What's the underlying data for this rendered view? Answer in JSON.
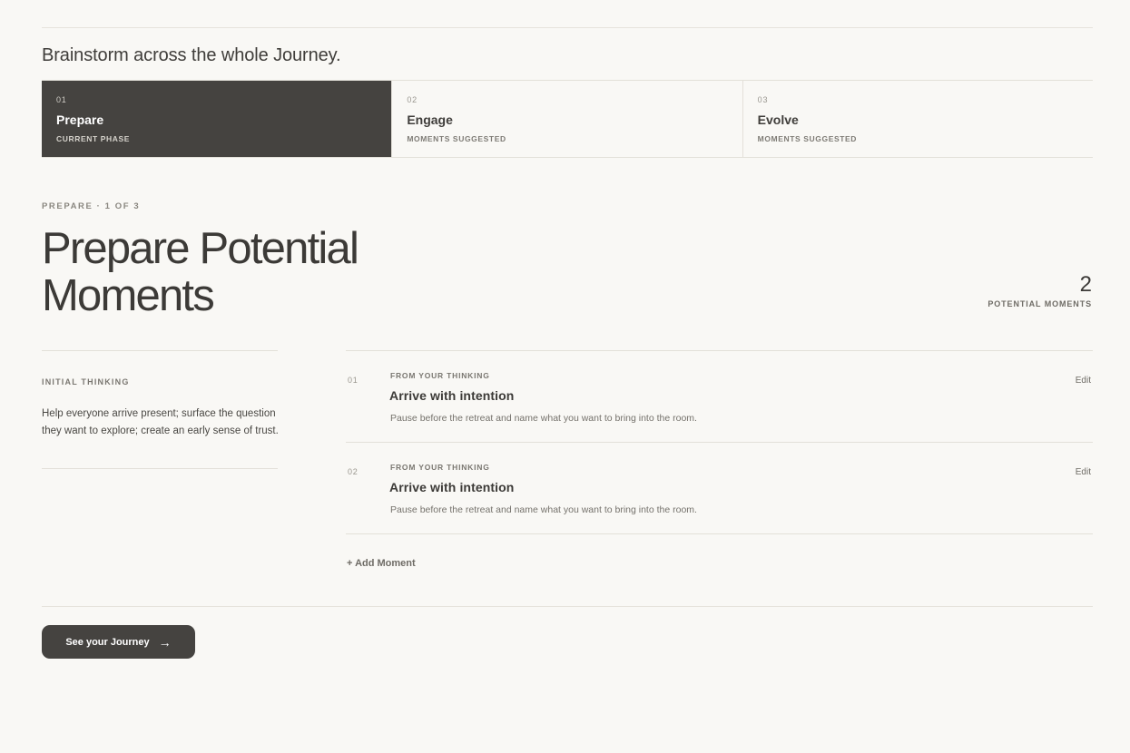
{
  "header": {
    "title": "Brainstorm across the whole Journey."
  },
  "phases": [
    {
      "number": "01",
      "name": "Prepare",
      "status": "CURRENT PHASE"
    },
    {
      "number": "02",
      "name": "Engage",
      "status": "MOMENTS SUGGESTED"
    },
    {
      "number": "03",
      "name": "Evolve",
      "status": "MOMENTS SUGGESTED"
    }
  ],
  "main": {
    "eyebrow": "PREPARE · 1 OF 3",
    "title": "Prepare Potential Moments",
    "count": "2",
    "count_label": "POTENTIAL MOMENTS"
  },
  "initial_thinking": {
    "label": "INITIAL THINKING",
    "text": "Help everyone arrive present; surface the question they want to explore; create an early sense of trust."
  },
  "moments": [
    {
      "number": "01",
      "source": "FROM YOUR THINKING",
      "title": "Arrive with intention",
      "description": "Pause before the retreat and name what you want to bring into the room.",
      "edit_label": "Edit"
    },
    {
      "number": "02",
      "source": "FROM YOUR THINKING",
      "title": "Arrive with intention",
      "description": "Pause before the retreat and name what you want to bring into the room.",
      "edit_label": "Edit"
    }
  ],
  "add_moment_label": "+ Add Moment",
  "cta": {
    "label": "See your Journey",
    "icon": "arrow-right-icon"
  },
  "colors": {
    "background": "#f9f8f5",
    "active_phase": "#454340",
    "text": "#3f3d3a"
  }
}
